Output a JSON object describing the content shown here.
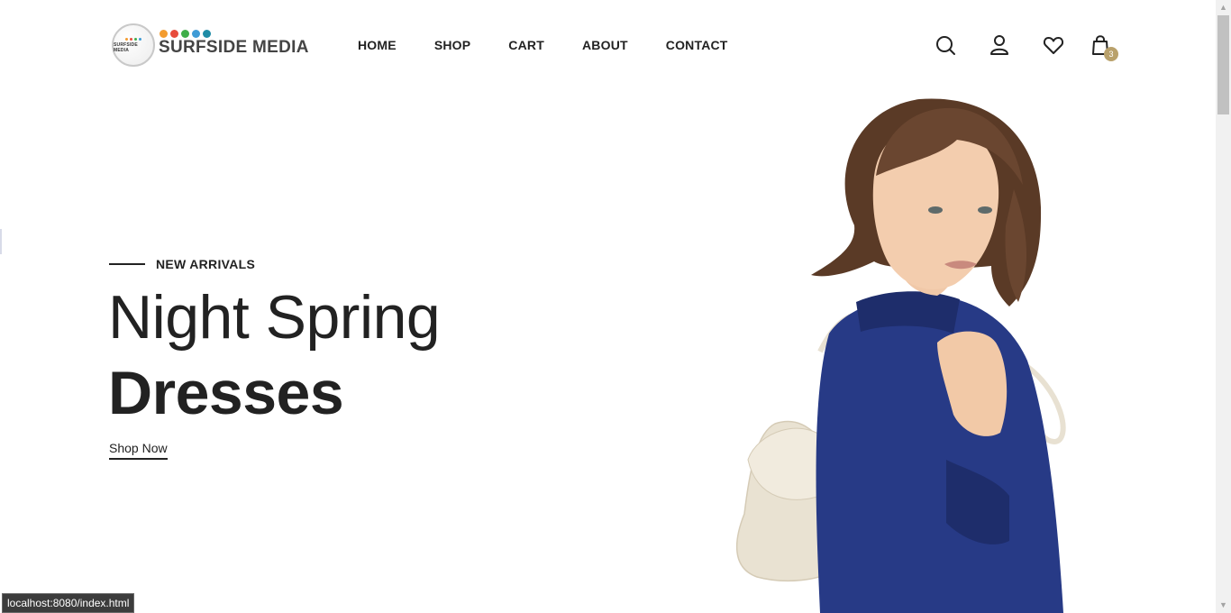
{
  "brand": {
    "name": "SURFSIDE MEDIA",
    "badge_text": "SURFSIDE MEDIA",
    "dot_colors": [
      "#f39c2f",
      "#e74c3c",
      "#3fae49",
      "#3f9bd6",
      "#1f8ca6"
    ]
  },
  "nav": {
    "items": [
      {
        "label": "HOME"
      },
      {
        "label": "SHOP"
      },
      {
        "label": "CART"
      },
      {
        "label": "ABOUT"
      },
      {
        "label": "CONTACT"
      }
    ]
  },
  "header_icons": {
    "search": "search-icon",
    "account": "user-icon",
    "wishlist": "heart-icon",
    "cart": "shopping-bag-icon",
    "cart_count": "3",
    "badge_color": "#b9a16b"
  },
  "hero": {
    "eyebrow": "NEW ARRIVALS",
    "title_light": "Night Spring",
    "title_bold": "Dresses",
    "cta": "Shop Now",
    "image": "woman-in-navy-dress-with-beige-handbag"
  },
  "status_bar": {
    "url": "localhost:8080/index.html"
  },
  "colors": {
    "text": "#222222",
    "accent": "#b9a16b",
    "dress": "#273a86"
  }
}
